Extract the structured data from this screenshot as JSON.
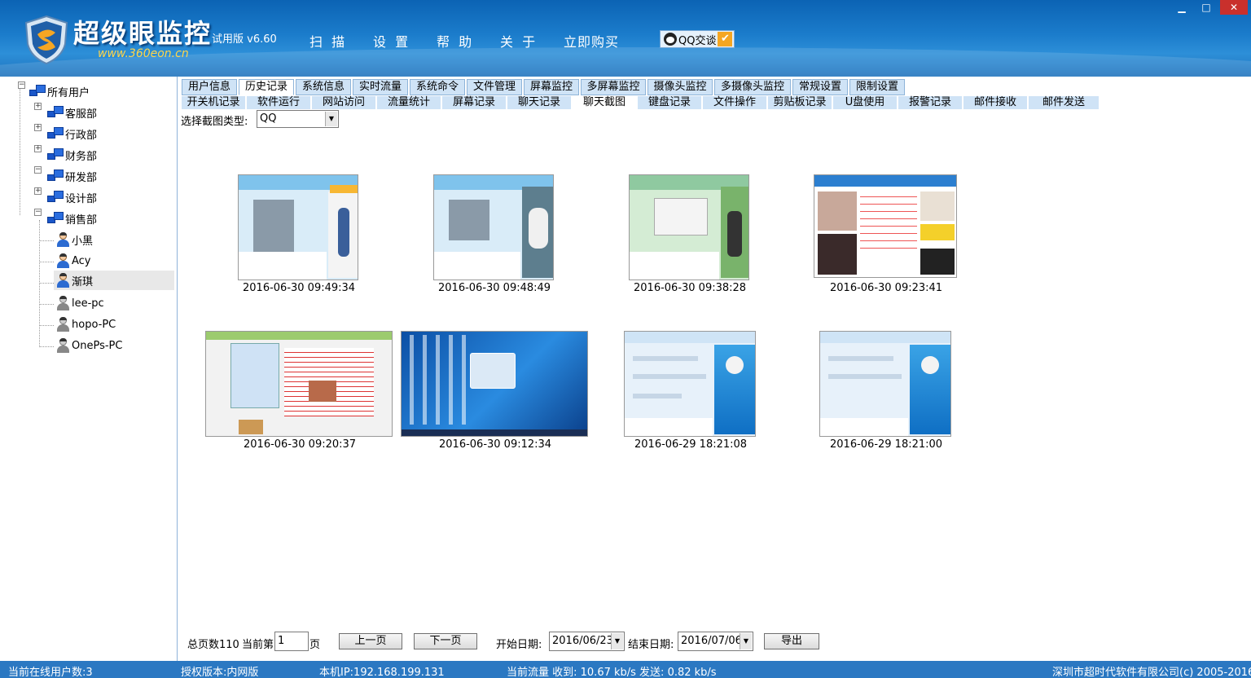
{
  "app": {
    "title": "超级眼监控",
    "url": "www.360eon.cn",
    "version": "试用版 v6.60",
    "menu": [
      "扫 描",
      "设 置",
      "帮 助",
      "关 于",
      "立即购买"
    ],
    "qq_chat": "QQ交谈",
    "window_buttons": [
      "▁",
      "□",
      "✕"
    ]
  },
  "tree": {
    "root": "所有用户",
    "groups": [
      "客服部",
      "行政部",
      "财务部",
      "研发部",
      "设计部",
      "销售部"
    ],
    "users": [
      {
        "name": "小黑",
        "online": true
      },
      {
        "name": "Acy",
        "online": true
      },
      {
        "name": "渐琪",
        "online": true
      },
      {
        "name": "lee-pc",
        "online": false
      },
      {
        "name": "hopo-PC",
        "online": false
      },
      {
        "name": "OnePs-PC",
        "online": false
      }
    ]
  },
  "tabs_main": [
    "用户信息",
    "历史记录",
    "系统信息",
    "实时流量",
    "系统命令",
    "文件管理",
    "屏幕监控",
    "多屏幕监控",
    "摄像头监控",
    "多摄像头监控",
    "常规设置",
    "限制设置"
  ],
  "tabs_sub": [
    "开关机记录",
    "软件运行",
    "网站访问",
    "流量统计",
    "屏幕记录",
    "聊天记录",
    "聊天截图",
    "键盘记录",
    "文件操作",
    "剪贴板记录",
    "U盘使用",
    "报警记录",
    "邮件接收",
    "邮件发送"
  ],
  "filter": {
    "label": "选择截图类型:",
    "selected": "QQ",
    "arrow": "▼"
  },
  "screenshots": [
    {
      "time": "2016-06-30 09:49:34",
      "kind": "qq-chat"
    },
    {
      "time": "2016-06-30 09:48:49",
      "kind": "qq-chat"
    },
    {
      "time": "2016-06-30 09:38:28",
      "kind": "qq-chat"
    },
    {
      "time": "2016-06-30 09:23:41",
      "kind": "web"
    },
    {
      "time": "2016-06-30 09:20:37",
      "kind": "web-wide"
    },
    {
      "time": "2016-06-30 09:12:34",
      "kind": "desktop"
    },
    {
      "time": "2016-06-29 18:21:08",
      "kind": "company-chat"
    },
    {
      "time": "2016-06-29 18:21:00",
      "kind": "company-chat"
    }
  ],
  "pager": {
    "total_label": "总页数110",
    "current_label": "当前第",
    "current_value": "1",
    "page_suffix": "页",
    "prev": "上一页",
    "next": "下一页",
    "start_label": "开始日期:",
    "start_value": "2016/06/23",
    "end_label": "结束日期:",
    "end_value": "2016/07/06",
    "export": "导出"
  },
  "status": {
    "online": "当前在线用户数:3",
    "license": "授权版本:内网版",
    "ip": "本机IP:192.168.199.131",
    "traffic": "当前流量 收到: 10.67 kb/s   发送: 0.82 kb/s",
    "copyright": "深圳市超时代软件有限公司(c) 2005-2016"
  },
  "colors": {
    "header": "#1b7ccb",
    "tab": "#cfe3f6",
    "status": "#2b78c2"
  }
}
